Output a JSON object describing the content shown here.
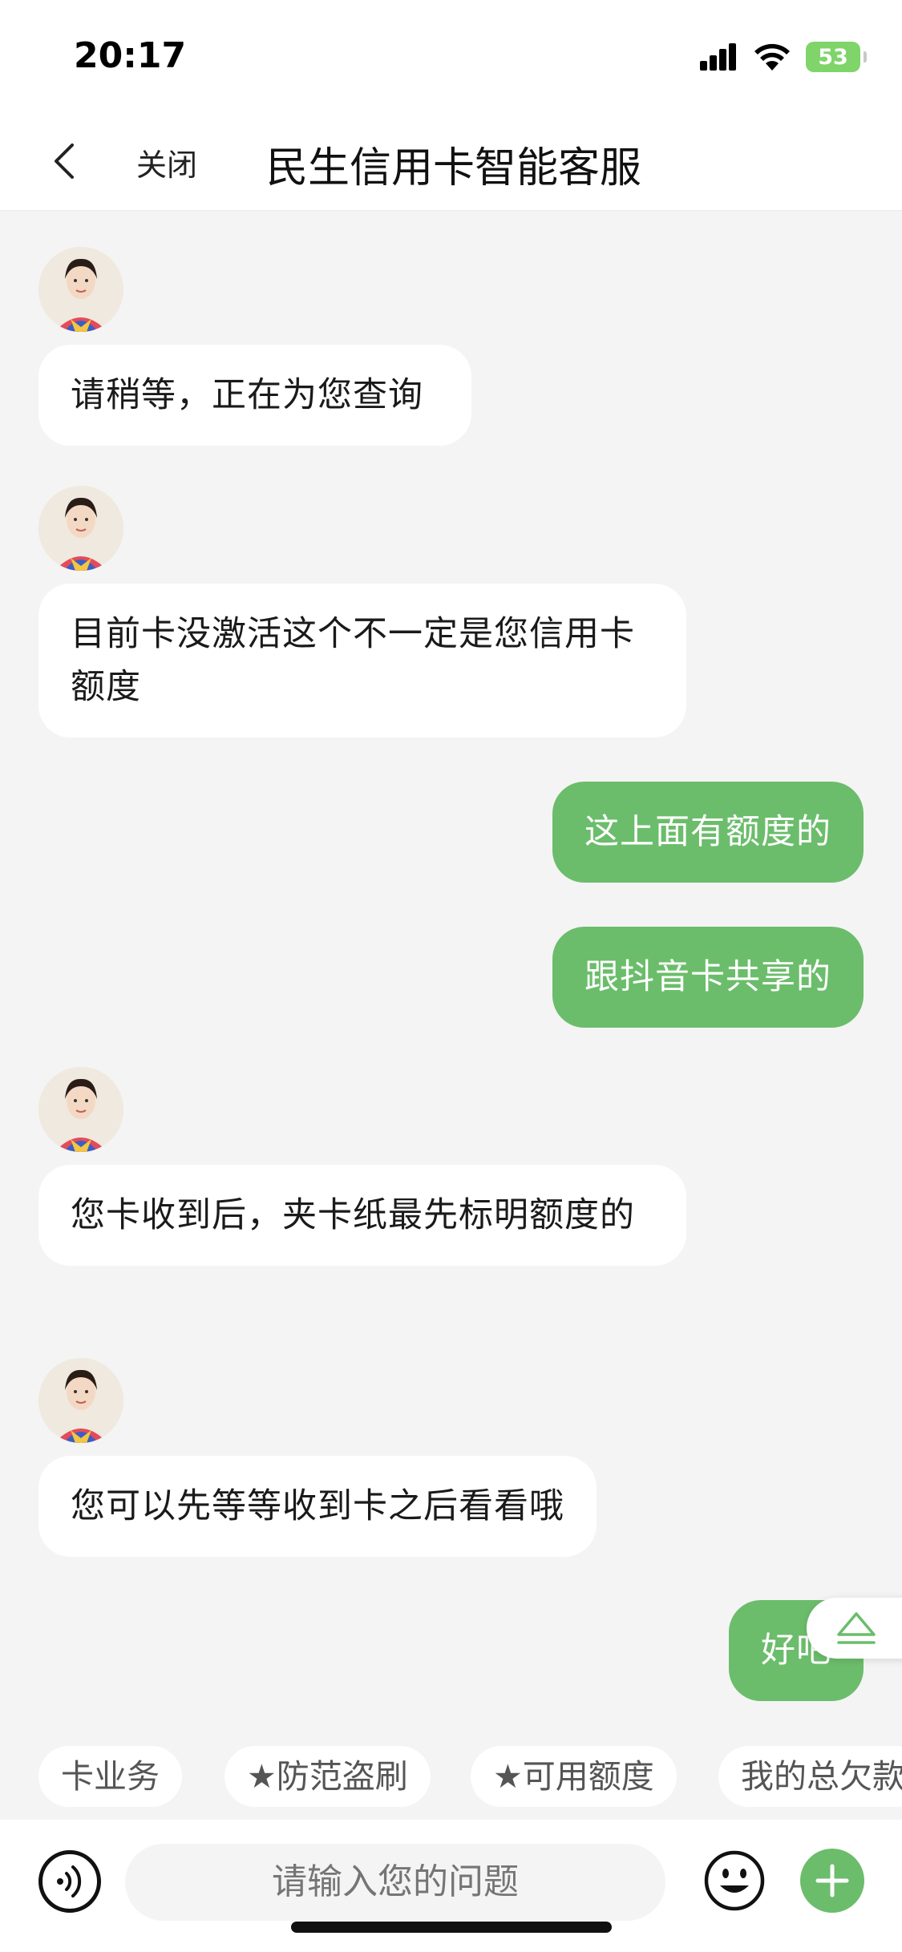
{
  "status": {
    "time": "20:17",
    "battery": "53"
  },
  "nav": {
    "close_label": "关闭",
    "title": "民生信用卡智能客服"
  },
  "messages": [
    {
      "from": "agent",
      "text": "请稍等，正在为您查询"
    },
    {
      "from": "agent",
      "text": "目前卡没激活这个不一定是您信用卡额度"
    },
    {
      "from": "user",
      "text": "这上面有额度的"
    },
    {
      "from": "user",
      "text": "跟抖音卡共享的"
    },
    {
      "from": "agent",
      "text": "您卡收到后，夹卡纸最先标明额度的"
    },
    {
      "from": "agent",
      "text": "您可以先等等收到卡之后看看哦"
    },
    {
      "from": "user",
      "text": "好吧"
    }
  ],
  "quick_replies": [
    "卡业务",
    "★防范盗刷",
    "★可用额度",
    "我的总欠款"
  ],
  "input": {
    "placeholder": "请输入您的问题"
  },
  "colors": {
    "accent": "#6bbd6b",
    "background": "#f4f4f4"
  }
}
